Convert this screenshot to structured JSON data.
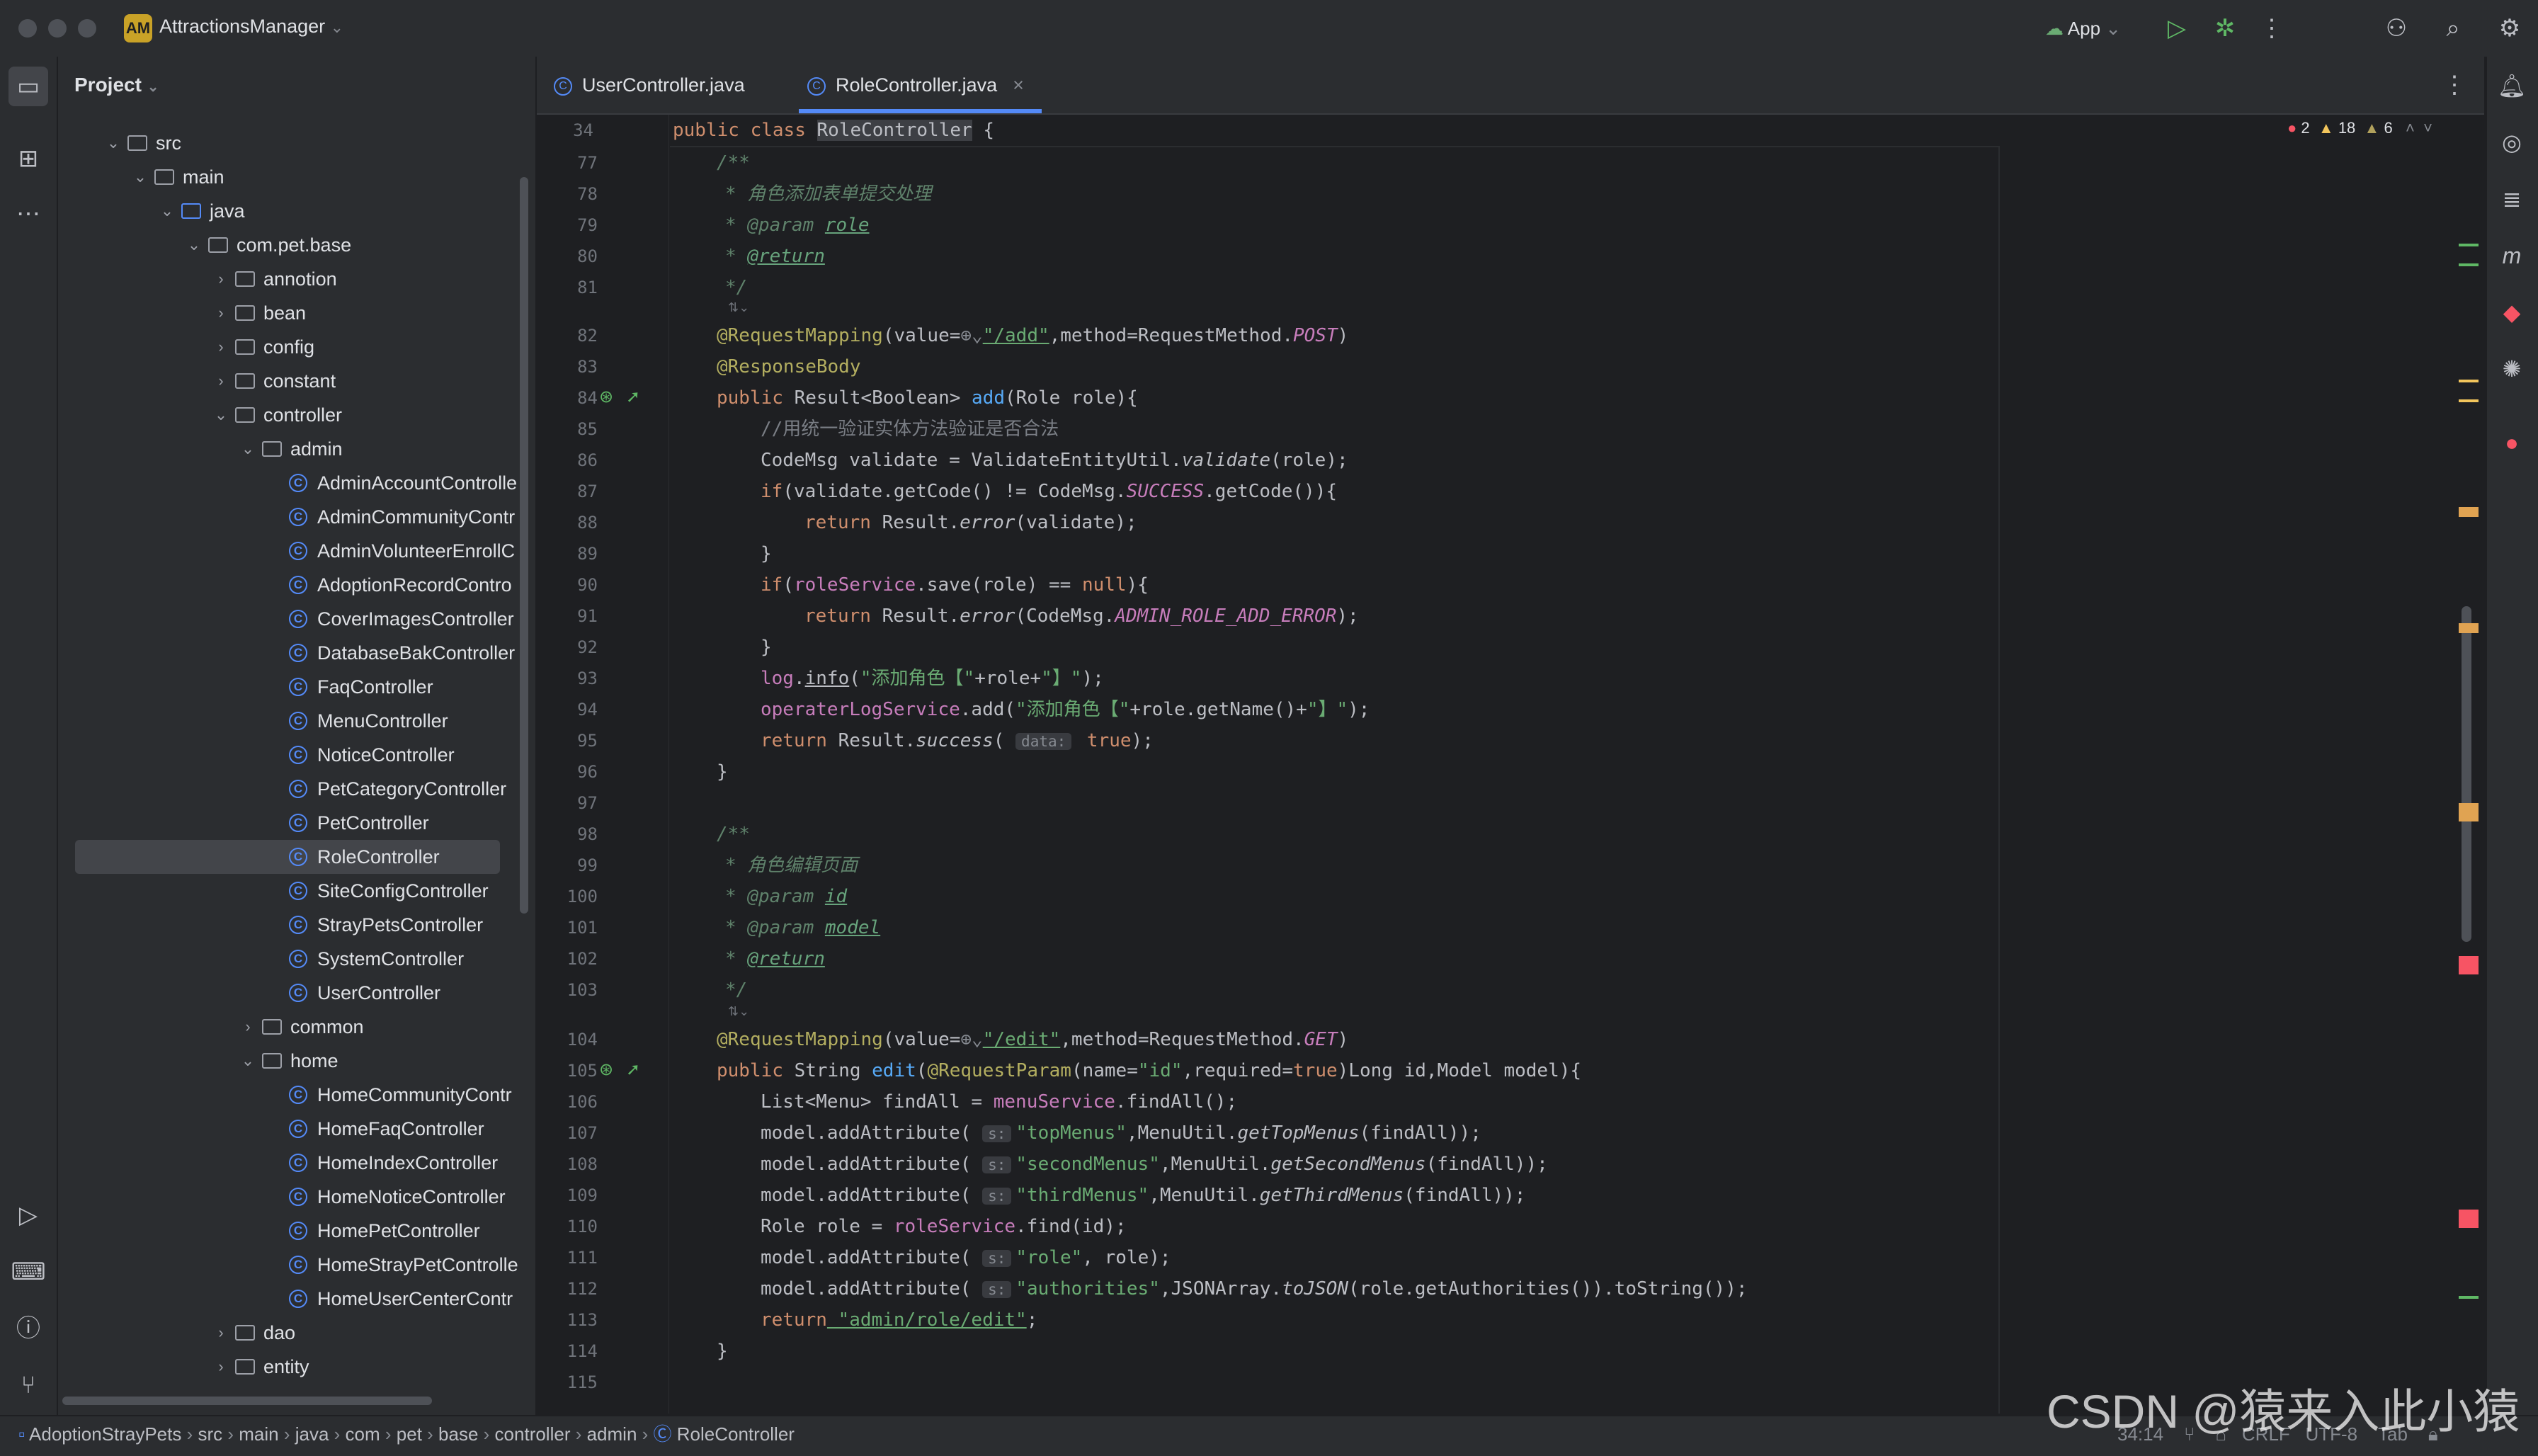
{
  "titlebar": {
    "project_badge": "AM",
    "project_name": "AttractionsManager",
    "run_config": "App"
  },
  "project_panel": {
    "header": "Project",
    "tree": [
      {
        "label": "src",
        "depth": 0,
        "expanded": true,
        "kind": "folder"
      },
      {
        "label": "main",
        "depth": 1,
        "expanded": true,
        "kind": "folder"
      },
      {
        "label": "java",
        "depth": 2,
        "expanded": true,
        "kind": "source-folder"
      },
      {
        "label": "com.pet.base",
        "depth": 3,
        "expanded": true,
        "kind": "package"
      },
      {
        "label": "annotion",
        "depth": 4,
        "expanded": false,
        "kind": "package"
      },
      {
        "label": "bean",
        "depth": 4,
        "expanded": false,
        "kind": "package"
      },
      {
        "label": "config",
        "depth": 4,
        "expanded": false,
        "kind": "package"
      },
      {
        "label": "constant",
        "depth": 4,
        "expanded": false,
        "kind": "package"
      },
      {
        "label": "controller",
        "depth": 4,
        "expanded": true,
        "kind": "package"
      },
      {
        "label": "admin",
        "depth": 5,
        "expanded": true,
        "kind": "package"
      },
      {
        "label": "AdminAccountControlle",
        "depth": 6,
        "kind": "class"
      },
      {
        "label": "AdminCommunityContr",
        "depth": 6,
        "kind": "class"
      },
      {
        "label": "AdminVolunteerEnrollC",
        "depth": 6,
        "kind": "class"
      },
      {
        "label": "AdoptionRecordContro",
        "depth": 6,
        "kind": "class"
      },
      {
        "label": "CoverImagesController",
        "depth": 6,
        "kind": "class"
      },
      {
        "label": "DatabaseBakController",
        "depth": 6,
        "kind": "class"
      },
      {
        "label": "FaqController",
        "depth": 6,
        "kind": "class"
      },
      {
        "label": "MenuController",
        "depth": 6,
        "kind": "class"
      },
      {
        "label": "NoticeController",
        "depth": 6,
        "kind": "class"
      },
      {
        "label": "PetCategoryController",
        "depth": 6,
        "kind": "class"
      },
      {
        "label": "PetController",
        "depth": 6,
        "kind": "class"
      },
      {
        "label": "RoleController",
        "depth": 6,
        "kind": "class",
        "selected": true
      },
      {
        "label": "SiteConfigController",
        "depth": 6,
        "kind": "class"
      },
      {
        "label": "StrayPetsController",
        "depth": 6,
        "kind": "class"
      },
      {
        "label": "SystemController",
        "depth": 6,
        "kind": "class"
      },
      {
        "label": "UserController",
        "depth": 6,
        "kind": "class"
      },
      {
        "label": "common",
        "depth": 5,
        "expanded": false,
        "kind": "package"
      },
      {
        "label": "home",
        "depth": 5,
        "expanded": true,
        "kind": "package"
      },
      {
        "label": "HomeCommunityContr",
        "depth": 6,
        "kind": "class"
      },
      {
        "label": "HomeFaqController",
        "depth": 6,
        "kind": "class"
      },
      {
        "label": "HomeIndexController",
        "depth": 6,
        "kind": "class"
      },
      {
        "label": "HomeNoticeController",
        "depth": 6,
        "kind": "class"
      },
      {
        "label": "HomePetController",
        "depth": 6,
        "kind": "class"
      },
      {
        "label": "HomeStrayPetControlle",
        "depth": 6,
        "kind": "class"
      },
      {
        "label": "HomeUserCenterContr",
        "depth": 6,
        "kind": "class"
      },
      {
        "label": "dao",
        "depth": 4,
        "expanded": false,
        "kind": "package"
      },
      {
        "label": "entity",
        "depth": 4,
        "expanded": false,
        "kind": "package"
      }
    ]
  },
  "editor": {
    "tabs": [
      {
        "label": "UserController.java",
        "active": false
      },
      {
        "label": "RoleController.java",
        "active": true,
        "close": "×"
      }
    ],
    "sticky_line": {
      "number": "34",
      "kw1": "public",
      "kw2": "class",
      "name": "RoleController",
      "rest": " {"
    },
    "inspections": {
      "errors": "2",
      "warnings": "18",
      "weak_warnings": "6"
    },
    "line_numbers": [
      "77",
      "78",
      "79",
      "80",
      "81",
      "82",
      "83",
      "84",
      "85",
      "86",
      "87",
      "88",
      "89",
      "90",
      "91",
      "92",
      "93",
      "94",
      "95",
      "96",
      "97",
      "98",
      "99",
      "100",
      "101",
      "102",
      "103",
      "104",
      "105",
      "106",
      "107",
      "108",
      "109",
      "110",
      "111",
      "112",
      "113",
      "114",
      "115"
    ],
    "code": {
      "l77": "/**",
      "l78": "* 角色添加表单提交处理",
      "l79_tag": "@param",
      "l79_name": "role",
      "l80_tag": "@return",
      "l81": "*/",
      "l82_ann": "@RequestMapping",
      "l82_a": "(value=",
      "l82_str": "\"/add\"",
      "l82_b": ",method=RequestMethod.",
      "l82_const": "POST",
      "l82_c": ")",
      "l83_ann": "@ResponseBody",
      "l84_kw": "public",
      "l84_a": " Result<Boolean> ",
      "l84_m": "add",
      "l84_b": "(Role role){",
      "l85": "//用统一验证实体方法验证是否合法",
      "l86_a": "CodeMsg validate = ValidateEntityUtil.",
      "l86_m": "validate",
      "l86_b": "(role);",
      "l87_kw": "if",
      "l87_a": "(validate.getCode() != CodeMsg.",
      "l87_const": "SUCCESS",
      "l87_b": ".getCode()){",
      "l88_kw": "return",
      "l88_a": " Result.",
      "l88_m": "error",
      "l88_b": "(validate);",
      "l89": "}",
      "l90_kw": "if",
      "l90_a": "(",
      "l90_f": "roleService",
      "l90_b": ".save(role) == ",
      "l90_null": "null",
      "l90_c": "){",
      "l91_kw": "return",
      "l91_a": " Result.",
      "l91_m": "error",
      "l91_b": "(CodeMsg.",
      "l91_const": "ADMIN_ROLE_ADD_ERROR",
      "l91_c": ");",
      "l92": "}",
      "l93_f": "log",
      "l93_a": ".",
      "l93_m": "info",
      "l93_b": "(",
      "l93_s1": "\"添加角色【\"",
      "l93_c": "+role+",
      "l93_s2": "\"】\"",
      "l93_d": ");",
      "l94_f": "operaterLogService",
      "l94_a": ".add(",
      "l94_s1": "\"添加角色【\"",
      "l94_b": "+role.getName()+",
      "l94_s2": "\"】\"",
      "l94_c": ");",
      "l95_kw": "return",
      "l95_a": " Result.",
      "l95_m": "success",
      "l95_b": "( ",
      "l95_hint": "data:",
      "l95_t": " true",
      "l95_c": ");",
      "l96": "}",
      "l98": "/**",
      "l99": "* 角色编辑页面",
      "l100_tag": "@param",
      "l100_name": "id",
      "l101_tag": "@param",
      "l101_name": "model",
      "l102_tag": "@return",
      "l103": "*/",
      "l104_ann": "@RequestMapping",
      "l104_a": "(value=",
      "l104_str": "\"/edit\"",
      "l104_b": ",method=RequestMethod.",
      "l104_const": "GET",
      "l104_c": ")",
      "l105_kw": "public",
      "l105_a": " String ",
      "l105_m": "edit",
      "l105_b": "(",
      "l105_ann": "@RequestParam",
      "l105_c": "(name=",
      "l105_s": "\"id\"",
      "l105_d": ",required=",
      "l105_t": "true",
      "l105_e": ")Long id,Model model){",
      "l106_a": "List<Menu> findAll = ",
      "l106_f": "menuService",
      "l106_b": ".findAll();",
      "l107_a": "model.addAttribute( ",
      "l107_hint": "s:",
      "l107_s": "\"topMenus\"",
      "l107_b": ",MenuUtil.",
      "l107_m": "getTopMenus",
      "l107_c": "(findAll));",
      "l108_a": "model.addAttribute( ",
      "l108_hint": "s:",
      "l108_s": "\"secondMenus\"",
      "l108_b": ",MenuUtil.",
      "l108_m": "getSecondMenus",
      "l108_c": "(findAll));",
      "l109_a": "model.addAttribute( ",
      "l109_hint": "s:",
      "l109_s": "\"thirdMenus\"",
      "l109_b": ",MenuUtil.",
      "l109_m": "getThirdMenus",
      "l109_c": "(findAll));",
      "l110_a": "Role role = ",
      "l110_f": "roleService",
      "l110_b": ".find(id);",
      "l111_a": "model.addAttribute( ",
      "l111_hint": "s:",
      "l111_s": "\"role\"",
      "l111_b": ", role);",
      "l112_a": "model.addAttribute( ",
      "l112_hint": "s:",
      "l112_s": "\"authorities\"",
      "l112_b": ",JSONArray.",
      "l112_m": "toJSON",
      "l112_c": "(role.getAuthorities()).toString());",
      "l113_kw": "return",
      "l113_s": " \"admin/role/edit\"",
      "l113_c": ";",
      "l114": "}"
    }
  },
  "statusbar": {
    "breadcrumbs": [
      "AdoptionStrayPets",
      "src",
      "main",
      "java",
      "com",
      "pet",
      "base",
      "controller",
      "admin",
      "RoleController"
    ],
    "position": "34:14",
    "line_sep": "CRLF",
    "encoding": "UTF-8",
    "indent": "Tab"
  },
  "watermark": "CSDN @猿来入此小猿"
}
